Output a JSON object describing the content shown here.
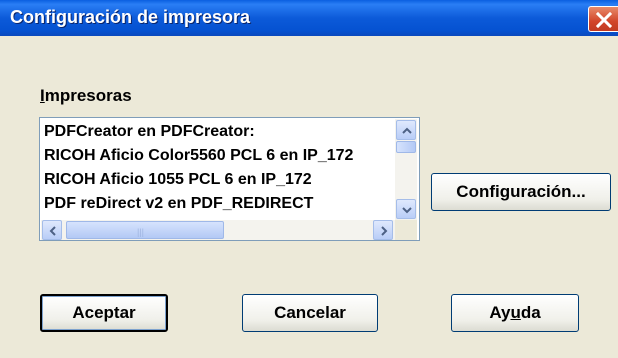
{
  "window": {
    "title": "Configuración de impresora",
    "close_label": "Cerrar"
  },
  "printers": {
    "label": "Impresoras",
    "label_access_key": "I",
    "label_rest": "mpresoras",
    "items": [
      "PDFCreator en PDFCreator:",
      "RICOH Aficio Color5560 PCL 6 en IP_172",
      "RICOH Aficio 1055 PCL 6 en IP_172",
      "PDF reDirect v2 en PDF_REDIRECT"
    ]
  },
  "buttons": {
    "configure": "Configuración...",
    "ok": "Aceptar",
    "cancel": "Cancelar",
    "help_pre": "Ay",
    "help_key": "u",
    "help_post": "da"
  },
  "colors": {
    "titlebar": "#0552d1",
    "dialog_bg": "#ece9d8",
    "close_button": "#d2452a"
  },
  "icons": {
    "close": "close-icon",
    "scroll_up": "arrow-up-icon",
    "scroll_down": "arrow-down-icon",
    "scroll_left": "arrow-left-icon",
    "scroll_right": "arrow-right-icon"
  }
}
